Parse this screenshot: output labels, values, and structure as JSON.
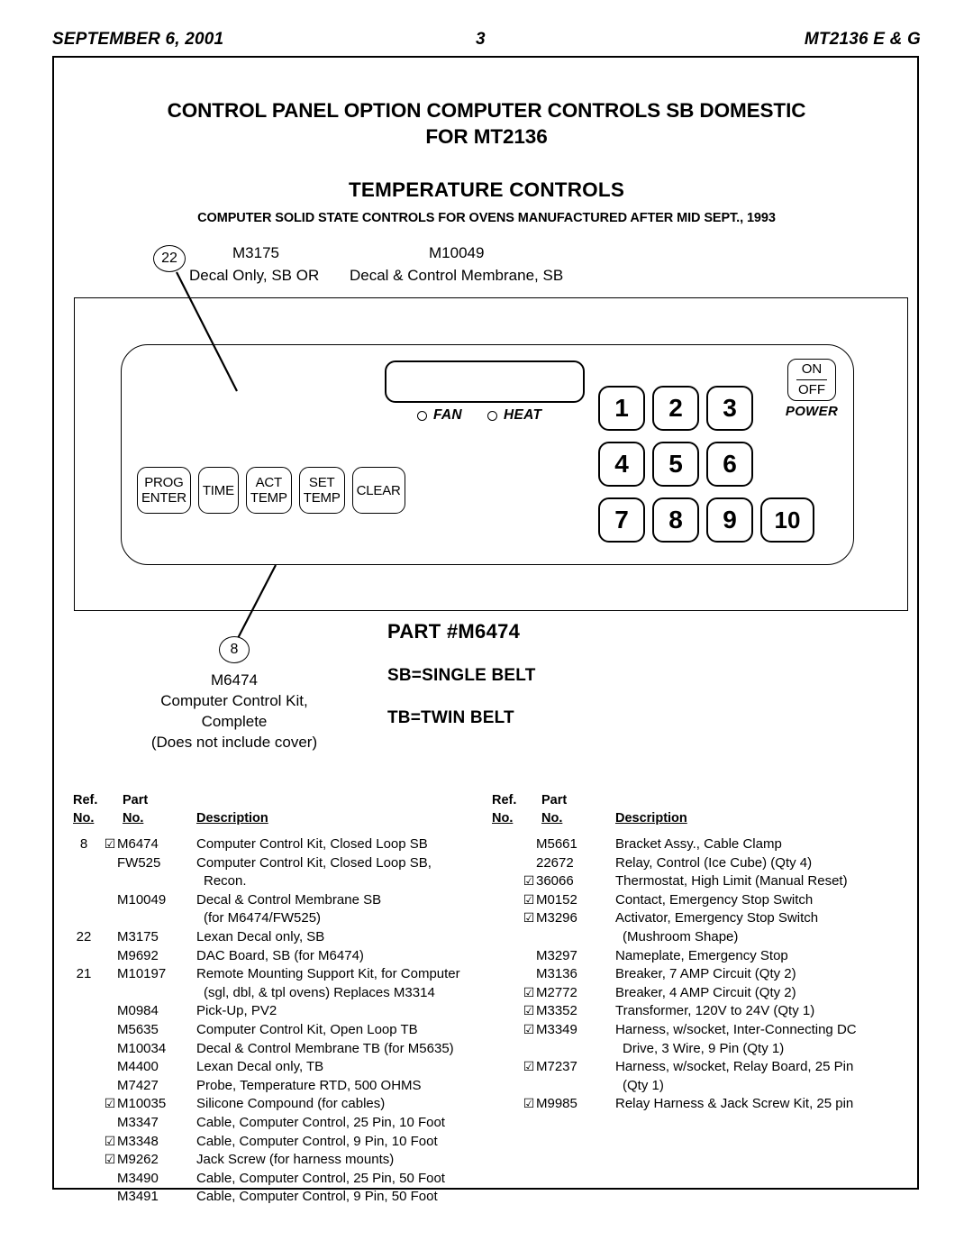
{
  "header": {
    "date": "SEPTEMBER 6, 2001",
    "page_number": "3",
    "model": "MT2136 E & G"
  },
  "title_block": {
    "line1": "CONTROL PANEL OPTION COMPUTER CONTROLS SB DOMESTIC",
    "line2": "FOR MT2136",
    "section": "TEMPERATURE CONTROLS",
    "note": "COMPUTER SOLID STATE CONTROLS FOR OVENS MANUFACTURED AFTER MID SEPT., 1993"
  },
  "callout_22": {
    "balloon": "22",
    "part_a": "M3175",
    "part_b": "M10049",
    "desc_a": "Decal Only, SB  OR",
    "desc_b": "Decal & Control Membrane, SB"
  },
  "callout_8": {
    "balloon": "8",
    "part": "M6474",
    "desc_line1": "Computer Control Kit,",
    "desc_line2": "Complete",
    "desc_line3": "(Does not include cover)"
  },
  "panel": {
    "indicators": [
      {
        "name": "fan-indicator",
        "label": "FAN"
      },
      {
        "name": "heat-indicator",
        "label": "HEAT"
      }
    ],
    "function_keys": [
      {
        "name": "prog-enter-key",
        "line1": "PROG",
        "line2": "ENTER"
      },
      {
        "name": "time-key",
        "line1": "TIME",
        "line2": ""
      },
      {
        "name": "act-temp-key",
        "line1": "ACT",
        "line2": "TEMP"
      },
      {
        "name": "set-temp-key",
        "line1": "SET",
        "line2": "TEMP"
      },
      {
        "name": "clear-key",
        "line1": "CLEAR",
        "line2": ""
      }
    ],
    "numeric_keys": [
      "1",
      "2",
      "3",
      "4",
      "5",
      "6",
      "7",
      "8",
      "9",
      "10"
    ],
    "power": {
      "on": "ON",
      "off": "OFF",
      "label": "POWER"
    }
  },
  "part_legend": {
    "part_number": "PART #M6474",
    "sb": "SB=SINGLE BELT",
    "tb": "TB=TWIN BELT"
  },
  "table": {
    "headers": {
      "ref_line1": "Ref.",
      "ref_line2": "No.",
      "part_line1": "Part",
      "part_line2": "No.",
      "description": "Description"
    },
    "check_glyph": "☑",
    "left_rows": [
      {
        "ref": "8",
        "check": true,
        "part": "M6474",
        "desc": "Computer Control Kit, Closed Loop SB"
      },
      {
        "ref": "",
        "check": false,
        "part": "FW525",
        "desc": "Computer Control Kit, Closed Loop SB,"
      },
      {
        "ref": "",
        "check": false,
        "part": "",
        "desc": "Recon.",
        "cont": true
      },
      {
        "ref": "",
        "check": false,
        "part": "M10049",
        "desc": "Decal & Control Membrane SB"
      },
      {
        "ref": "",
        "check": false,
        "part": "",
        "desc": "(for M6474/FW525)",
        "cont": true
      },
      {
        "ref": "22",
        "check": false,
        "part": "M3175",
        "desc": "Lexan Decal only, SB"
      },
      {
        "ref": "",
        "check": false,
        "part": "M9692",
        "desc": "DAC Board, SB (for M6474)"
      },
      {
        "ref": "21",
        "check": false,
        "part": "M10197",
        "desc": "Remote Mounting Support Kit, for Computer"
      },
      {
        "ref": "",
        "check": false,
        "part": "",
        "desc": "(sgl, dbl, & tpl ovens) Replaces M3314",
        "cont": true
      },
      {
        "ref": "",
        "check": false,
        "part": "M0984",
        "desc": "Pick-Up, PV2"
      },
      {
        "ref": "",
        "check": false,
        "part": "M5635",
        "desc": "Computer Control Kit, Open Loop TB"
      },
      {
        "ref": "",
        "check": false,
        "part": "M10034",
        "desc": "Decal & Control Membrane TB (for M5635)"
      },
      {
        "ref": "",
        "check": false,
        "part": "M4400",
        "desc": "Lexan Decal only, TB"
      },
      {
        "ref": "",
        "check": false,
        "part": "M7427",
        "desc": "Probe, Temperature RTD, 500 OHMS"
      },
      {
        "ref": "",
        "check": true,
        "part": "M10035",
        "desc": "Silicone Compound (for cables)"
      },
      {
        "ref": "",
        "check": false,
        "part": "M3347",
        "desc": "Cable, Computer Control, 25 Pin, 10 Foot"
      },
      {
        "ref": "",
        "check": true,
        "part": "M3348",
        "desc": "Cable, Computer Control, 9 Pin, 10 Foot"
      },
      {
        "ref": "",
        "check": true,
        "part": "M9262",
        "desc": "Jack Screw (for harness mounts)"
      },
      {
        "ref": "",
        "check": false,
        "part": "M3490",
        "desc": "Cable, Computer Control, 25 Pin, 50 Foot"
      },
      {
        "ref": "",
        "check": false,
        "part": "M3491",
        "desc": "Cable, Computer Control, 9 Pin, 50 Foot"
      }
    ],
    "right_rows": [
      {
        "ref": "",
        "check": false,
        "part": "M5661",
        "desc": "Bracket Assy., Cable Clamp"
      },
      {
        "ref": "",
        "check": false,
        "part": "22672",
        "desc": "Relay, Control (Ice Cube) (Qty 4)"
      },
      {
        "ref": "",
        "check": true,
        "part": "36066",
        "desc": "Thermostat, High Limit (Manual Reset)"
      },
      {
        "ref": "",
        "check": true,
        "part": "M0152",
        "desc": "Contact, Emergency Stop Switch"
      },
      {
        "ref": "",
        "check": true,
        "part": "M3296",
        "desc": "Activator, Emergency Stop Switch"
      },
      {
        "ref": "",
        "check": false,
        "part": "",
        "desc": "(Mushroom Shape)",
        "cont": true
      },
      {
        "ref": "",
        "check": false,
        "part": "M3297",
        "desc": "Nameplate, Emergency Stop"
      },
      {
        "ref": "",
        "check": false,
        "part": "M3136",
        "desc": "Breaker, 7 AMP Circuit (Qty 2)"
      },
      {
        "ref": "",
        "check": true,
        "part": "M2772",
        "desc": "Breaker, 4 AMP Circuit (Qty 2)"
      },
      {
        "ref": "",
        "check": true,
        "part": "M3352",
        "desc": "Transformer, 120V to 24V (Qty 1)"
      },
      {
        "ref": "",
        "check": true,
        "part": "M3349",
        "desc": "Harness, w/socket, Inter-Connecting DC"
      },
      {
        "ref": "",
        "check": false,
        "part": "",
        "desc": "Drive, 3 Wire, 9 Pin (Qty 1)",
        "cont": true
      },
      {
        "ref": "",
        "check": true,
        "part": "M7237",
        "desc": "Harness, w/socket, Relay Board, 25 Pin"
      },
      {
        "ref": "",
        "check": false,
        "part": "",
        "desc": "(Qty 1)",
        "cont": true
      },
      {
        "ref": "",
        "check": true,
        "part": "M9985",
        "desc": "Relay Harness & Jack Screw Kit, 25 pin"
      }
    ]
  }
}
